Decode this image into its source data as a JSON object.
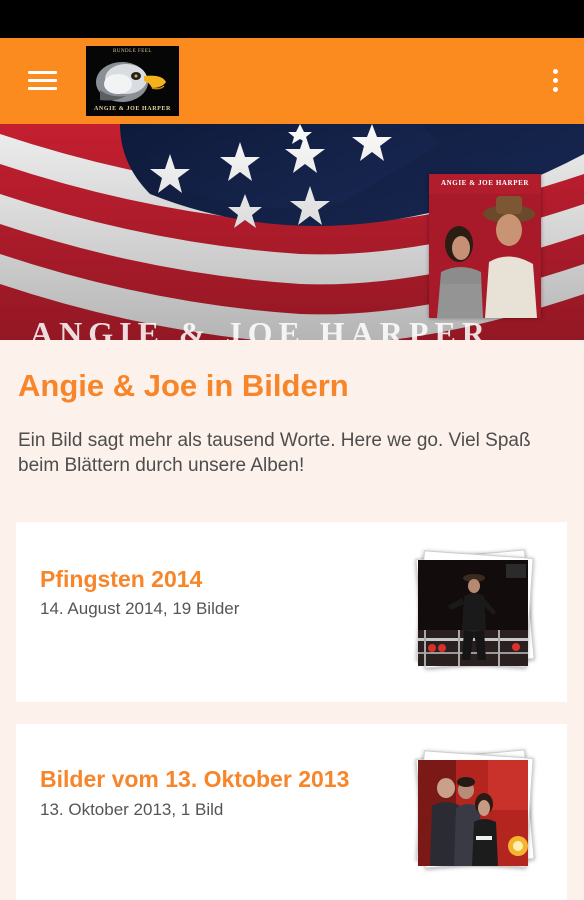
{
  "app_bar": {
    "logo_text_top": "BUNDLE FEEL",
    "logo_text_bottom": "ANGIE & JOE HARPER",
    "brand_color": "#fb8a1f",
    "menu_icon": "hamburger-menu-icon",
    "more_icon": "more-vert-icon"
  },
  "hero": {
    "caption": "ANGIE & JOE HARPER",
    "poster_title": "ANGIE & JOE HARPER"
  },
  "page": {
    "title": "Angie & Joe in Bildern",
    "intro": "Ein Bild sagt mehr als tausend Worte. Here we go. Viel Spaß beim Blättern durch unsere Alben!"
  },
  "albums": [
    {
      "title": "Pfingsten 2014",
      "meta": "14. August 2014, 19 Bilder"
    },
    {
      "title": "Bilder vom 13. Oktober 2013",
      "meta": "13. Oktober 2013, 1 Bild"
    }
  ],
  "colors": {
    "accent": "#f7852a",
    "page_background": "#fdf1ec",
    "text": "#4d4d4d"
  }
}
